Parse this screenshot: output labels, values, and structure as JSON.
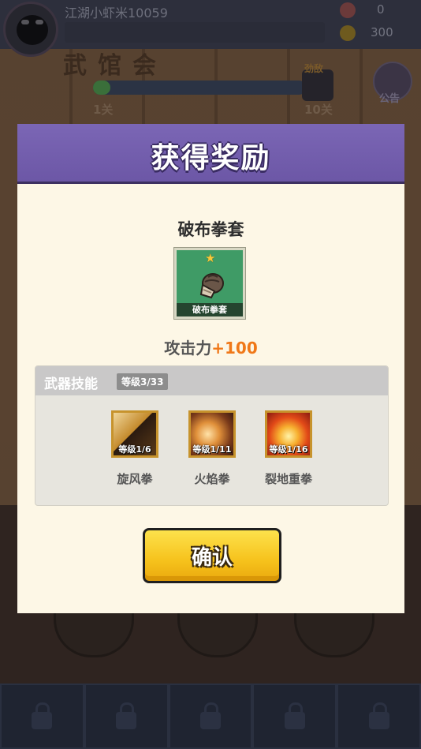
{
  "hud": {
    "player_name": "江湖小虾米10059",
    "gems": "0",
    "coins": "300",
    "sign_text": "武馆会",
    "stage_start": "1关",
    "stage_end": "10关",
    "boss_tag": "劲敌",
    "notice_label": "公告",
    "stage_progress": 0.08
  },
  "modal": {
    "title": "获得奖励",
    "item": {
      "name": "破布拳套",
      "caption": "破布拳套",
      "stars": 1
    },
    "stat": {
      "label": "攻击力",
      "value": "+100"
    },
    "skills": {
      "title": "武器技能",
      "level": "等级3/33",
      "items": [
        {
          "name": "旋风拳",
          "level": "等级1/6"
        },
        {
          "name": "火焰拳",
          "level": "等级1/11"
        },
        {
          "name": "裂地重拳",
          "level": "等级1/16"
        }
      ]
    },
    "confirm_label": "确认"
  },
  "colors": {
    "header": "#6c57a6",
    "modal_bg": "#fdf7e6",
    "stat_value": "#f07818",
    "button": "#f6c21c"
  }
}
